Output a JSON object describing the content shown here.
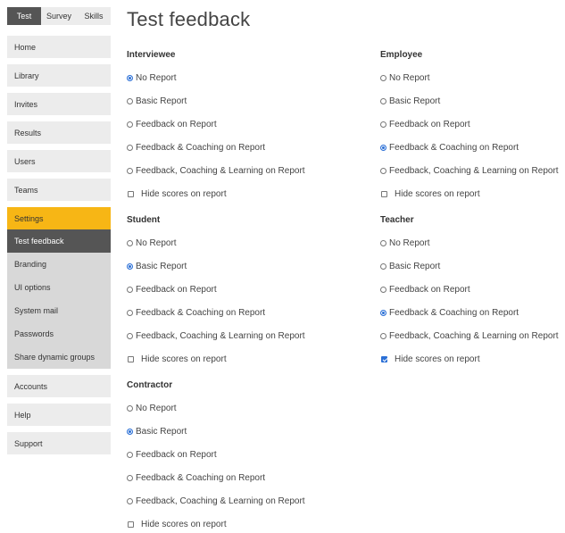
{
  "top_tabs": [
    "Test",
    "Survey",
    "Skills"
  ],
  "nav": {
    "home": "Home",
    "library": "Library",
    "invites": "Invites",
    "results": "Results",
    "users": "Users",
    "teams": "Teams",
    "settings": "Settings",
    "settings_sub": [
      "Test feedback",
      "Branding",
      "UI options",
      "System mail",
      "Passwords",
      "Share dynamic groups"
    ],
    "accounts": "Accounts",
    "help": "Help",
    "support": "Support"
  },
  "page": {
    "title": "Test feedback"
  },
  "options": [
    "No Report",
    "Basic Report",
    "Feedback on Report",
    "Feedback & Coaching on Report",
    "Feedback, Coaching & Learning on Report"
  ],
  "hide_scores_label": "Hide scores on report",
  "sections": {
    "interviewee": {
      "title": "Interviewee",
      "selected": 0,
      "hide_scores": false
    },
    "employee": {
      "title": "Employee",
      "selected": 3,
      "hide_scores": false
    },
    "student": {
      "title": "Student",
      "selected": 1,
      "hide_scores": false
    },
    "teacher": {
      "title": "Teacher",
      "selected": 3,
      "hide_scores": true
    },
    "contractor": {
      "title": "Contractor",
      "selected": 1,
      "hide_scores": false
    }
  },
  "colors": {
    "accent": "#f7b615",
    "active_dark": "#555555",
    "radio_selected": "#2a6fd6"
  }
}
